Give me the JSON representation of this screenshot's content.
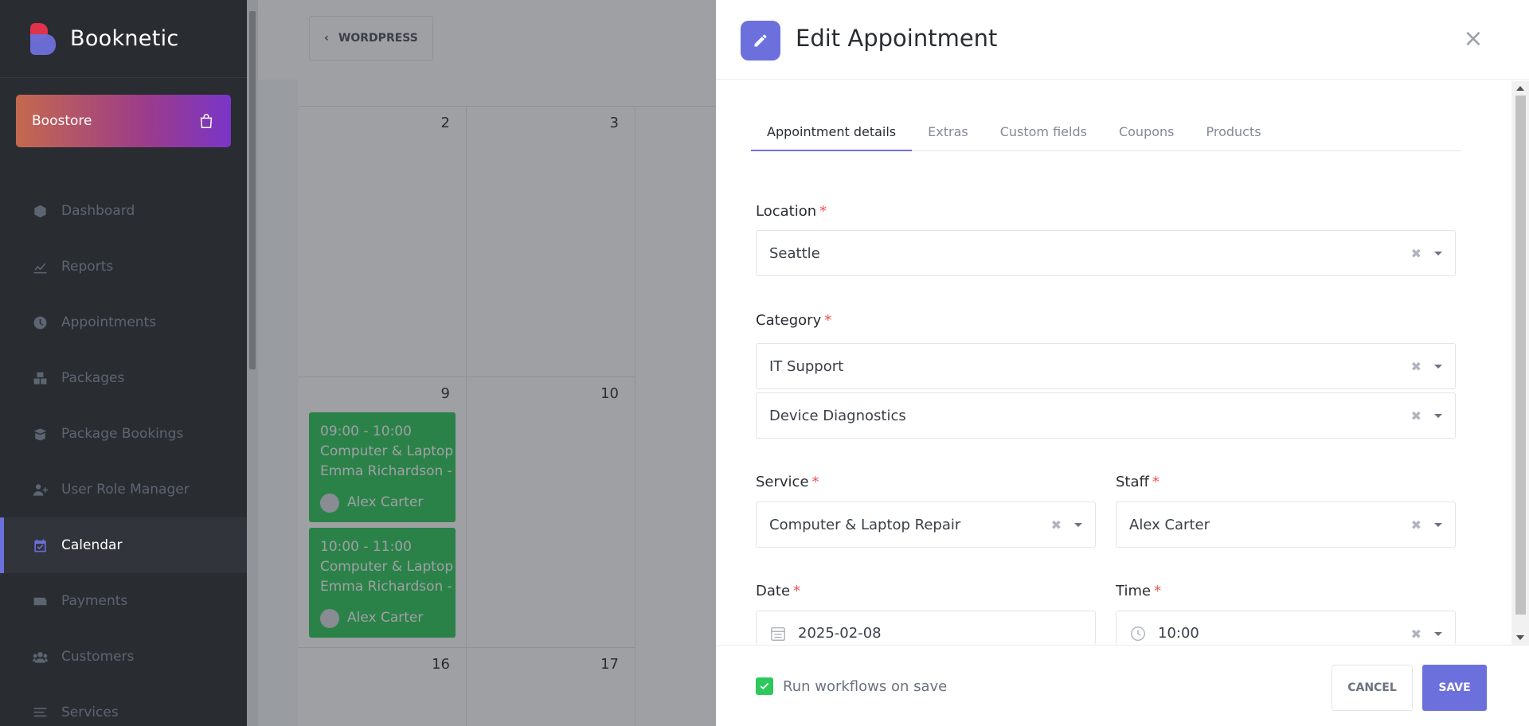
{
  "brand": {
    "name": "Booknetic"
  },
  "boostore": {
    "label": "Boostore"
  },
  "sidebar": {
    "items": [
      {
        "label": "Dashboard",
        "icon": "cube-icon"
      },
      {
        "label": "Reports",
        "icon": "chart-icon"
      },
      {
        "label": "Appointments",
        "icon": "clock-icon"
      },
      {
        "label": "Packages",
        "icon": "boxes-icon"
      },
      {
        "label": "Package Bookings",
        "icon": "box-open-icon"
      },
      {
        "label": "User Role Manager",
        "icon": "user-plus-icon"
      },
      {
        "label": "Calendar",
        "icon": "calendar-check-icon",
        "active": true
      },
      {
        "label": "Payments",
        "icon": "wallet-icon"
      },
      {
        "label": "Customers",
        "icon": "users-icon"
      },
      {
        "label": "Services",
        "icon": "list-icon"
      }
    ]
  },
  "topbar": {
    "wordpress_label": "WORDPRESS"
  },
  "calendar": {
    "days": [
      "2",
      "3",
      "9",
      "10",
      "16",
      "17"
    ],
    "events": [
      {
        "time": "09:00 - 10:00",
        "service": "Computer & Laptop Repair",
        "customer": "Emma Richardson -",
        "staff": "Alex Carter"
      },
      {
        "time": "10:00 - 11:00",
        "service": "Computer & Laptop Repair",
        "customer": "Emma Richardson -",
        "staff": "Alex Carter"
      }
    ]
  },
  "panel": {
    "title": "Edit Appointment",
    "close_symbol": "×",
    "tabs": [
      "Appointment details",
      "Extras",
      "Custom fields",
      "Coupons",
      "Products"
    ],
    "form": {
      "location_label": "Location",
      "location_value": "Seattle",
      "category_label": "Category",
      "category_value": "IT Support",
      "subcategory_value": "Device Diagnostics",
      "service_label": "Service",
      "service_value": "Computer & Laptop Repair",
      "staff_label": "Staff",
      "staff_value": "Alex Carter",
      "date_label": "Date",
      "date_value": "2025-02-08",
      "time_label": "Time",
      "time_value": "10:00",
      "required_mark": "*",
      "clear_symbol": "✖"
    },
    "footer": {
      "workflow_label": "Run workflows on save",
      "workflow_checked": true,
      "cancel_label": "CANCEL",
      "save_label": "SAVE"
    }
  },
  "colors": {
    "accent": "#6c70dc",
    "event": "#2ec95c",
    "sidebar": "#292d32",
    "required": "#f05252"
  }
}
